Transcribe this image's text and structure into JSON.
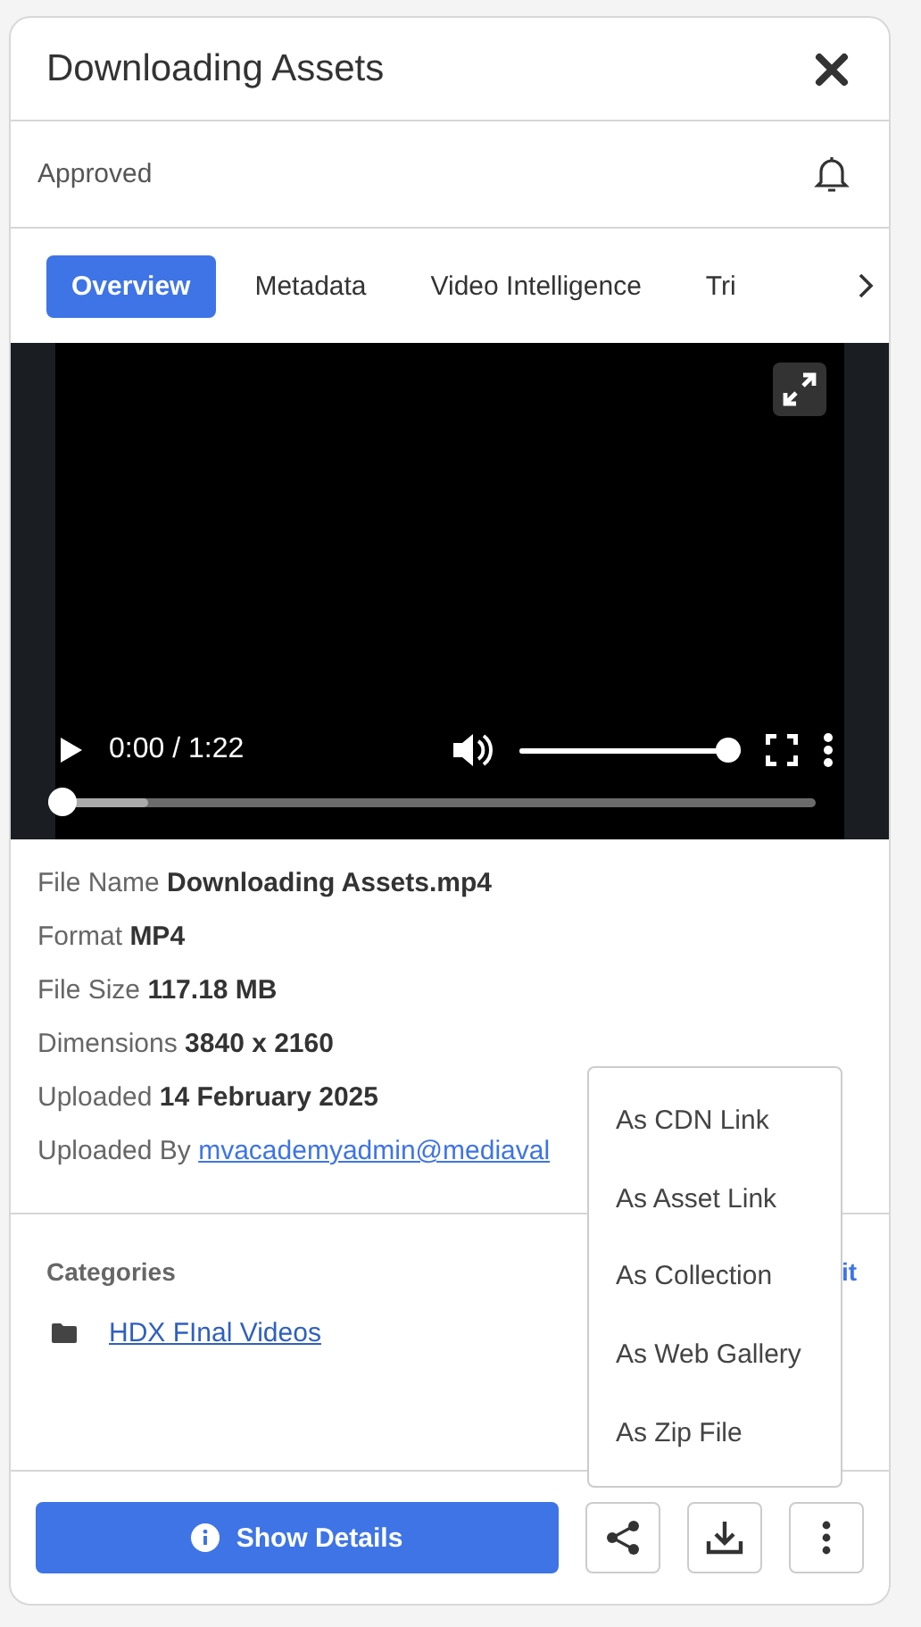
{
  "title": "Downloading Assets",
  "status": "Approved",
  "tabs": [
    {
      "label": "Overview",
      "selected": true
    },
    {
      "label": "Metadata",
      "selected": false
    },
    {
      "label": "Video Intelligence",
      "selected": false
    },
    {
      "label": "Tri",
      "selected": false
    }
  ],
  "player": {
    "time": "0:00 / 1:22",
    "progress": {
      "level": 0
    },
    "buffer": {
      "level": 0.13
    },
    "volume": {
      "level": 1
    }
  },
  "details": [
    {
      "label": "File Name",
      "value": "Downloading Assets.mp4",
      "kind": "text"
    },
    {
      "label": "Format",
      "value": "MP4",
      "kind": "text"
    },
    {
      "label": "File Size",
      "value": "117.18 MB",
      "kind": "text"
    },
    {
      "label": "Dimensions",
      "value": "3840 x 2160",
      "kind": "text"
    },
    {
      "label": "Uploaded",
      "value": "14 February 2025",
      "kind": "text"
    },
    {
      "label": "Uploaded By",
      "value": "mvacademyadmin@mediaval",
      "kind": "link"
    }
  ],
  "categories": {
    "title": "Categories",
    "edit": "it",
    "items": [
      {
        "name": "HDX FInal Videos"
      }
    ]
  },
  "footer": {
    "details_button": "Show Details"
  },
  "share_menu": [
    "As CDN Link",
    "As Asset Link",
    "As Collection",
    "As Web Gallery",
    "As Zip File"
  ]
}
